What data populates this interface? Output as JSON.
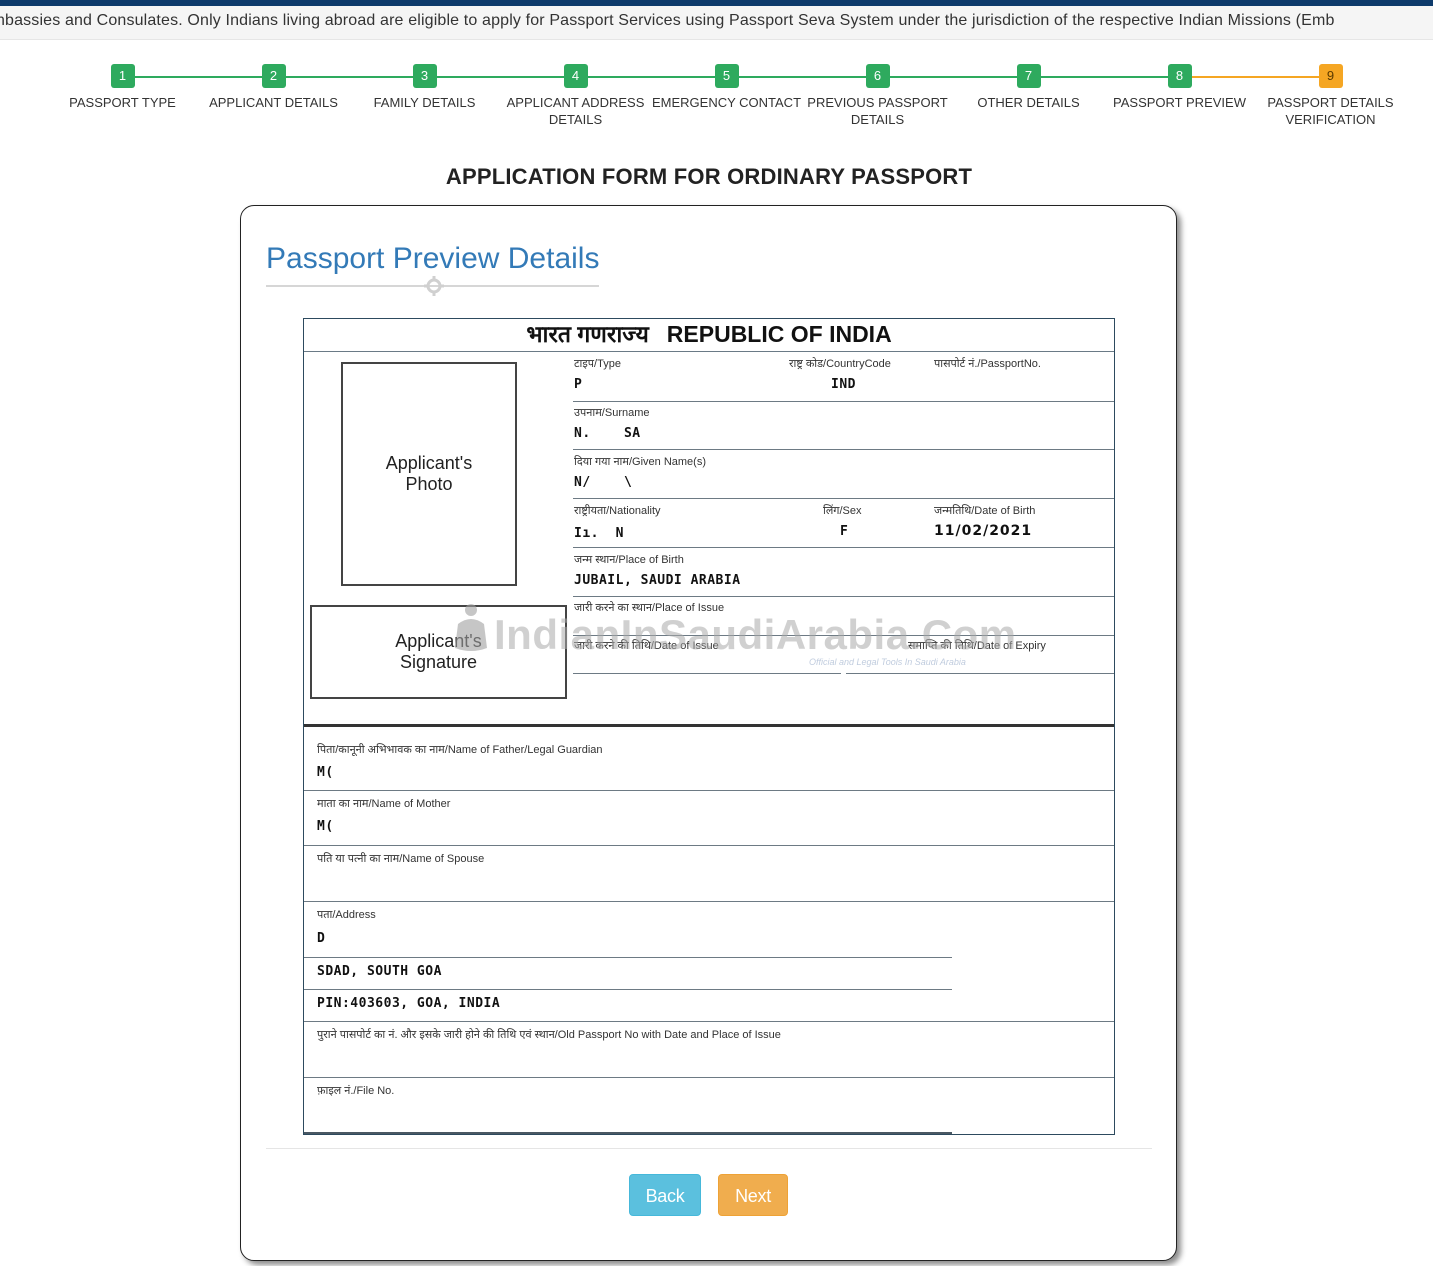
{
  "notice": {
    "text": "nbassies and Consulates. Only Indians living abroad are eligible to apply for Passport Services using Passport Seva System under the jurisdiction of the respective Indian Missions (Emb"
  },
  "colors": {
    "top_bar": "#0d3a6b",
    "step_complete": "#2eaa5e",
    "step_current": "#f5a623",
    "heading": "#337ab7",
    "back_button": "#5bc0de",
    "next_button": "#f0ad4e"
  },
  "stepper": {
    "current_step": 9,
    "steps": [
      {
        "num": "1",
        "label": "PASSPORT TYPE",
        "status": "complete"
      },
      {
        "num": "2",
        "label": "APPLICANT DETAILS",
        "status": "complete"
      },
      {
        "num": "3",
        "label": "FAMILY DETAILS",
        "status": "complete"
      },
      {
        "num": "4",
        "label": "APPLICANT ADDRESS DETAILS",
        "status": "complete"
      },
      {
        "num": "5",
        "label": "EMERGENCY CONTACT",
        "status": "complete"
      },
      {
        "num": "6",
        "label": "PREVIOUS PASSPORT DETAILS",
        "status": "complete"
      },
      {
        "num": "7",
        "label": "OTHER DETAILS",
        "status": "complete"
      },
      {
        "num": "8",
        "label": "PASSPORT PREVIEW",
        "status": "complete"
      },
      {
        "num": "9",
        "label": "PASSPORT DETAILS VERIFICATION",
        "status": "current"
      }
    ]
  },
  "page": {
    "form_title": "APPLICATION FORM FOR ORDINARY PASSPORT",
    "card_heading": "Passport Preview Details"
  },
  "passport": {
    "header_hindi": "भारत गणराज्य",
    "header_english": "REPUBLIC OF INDIA",
    "photo_placeholder": "Applicant's Photo",
    "signature_placeholder": "Applicant's Signature",
    "fields": {
      "type": {
        "label": "टाइप/Type",
        "value": "P"
      },
      "country_code": {
        "label": "राष्ट्र कोड/CountryCode",
        "value": "IND"
      },
      "passport_no": {
        "label": "पासपोर्ट नं./PassportNo.",
        "value": ""
      },
      "surname": {
        "label": "उपनाम/Surname",
        "value": "N.    SA"
      },
      "given_names": {
        "label": "दिया गया नाम/Given Name(s)",
        "value": "N/    \\"
      },
      "nationality": {
        "label": "राष्ट्रीयता/Nationality",
        "value": "Iı.  N"
      },
      "sex": {
        "label": "लिंग/Sex",
        "value": "F"
      },
      "dob": {
        "label": "जन्मतिथि/Date of Birth",
        "value": "11/02/2021"
      },
      "place_of_birth": {
        "label": "जन्म स्थान/Place of Birth",
        "value": "JUBAIL, SAUDI ARABIA"
      },
      "place_of_issue": {
        "label": "जारी करने का स्थान/Place of Issue",
        "value": ""
      },
      "date_of_issue": {
        "label": "जारी करने की तिथि/Date of Issue",
        "value": ""
      },
      "date_of_expiry": {
        "label": "समाप्ति की तिथि/Date of Expiry",
        "value": ""
      },
      "father": {
        "label": "पिता/कानूनी अभिभावक का नाम/Name of Father/Legal Guardian",
        "value": "M("
      },
      "mother": {
        "label": "माता का नाम/Name of Mother",
        "value": "M("
      },
      "spouse": {
        "label": "पति या पत्नी का नाम/Name of Spouse",
        "value": ""
      },
      "address": {
        "label": "पता/Address",
        "lines": [
          "D",
          "SDAD, SOUTH GOA",
          "PIN:403603, GOA, INDIA"
        ]
      },
      "old_passport": {
        "label": "पुराने पासपोर्ट का नं. और इसके जारी होने की तिथि एवं स्थान/Old Passport No with Date and Place of Issue",
        "value": ""
      },
      "file_no": {
        "label": "फ़ाइल नं./File No.",
        "value": ""
      }
    },
    "watermark": "IndianInSaudiArabia.Com",
    "watermark_sub": "Official and Legal Tools In Saudi Arabia"
  },
  "buttons": {
    "back": "Back",
    "next": "Next"
  }
}
